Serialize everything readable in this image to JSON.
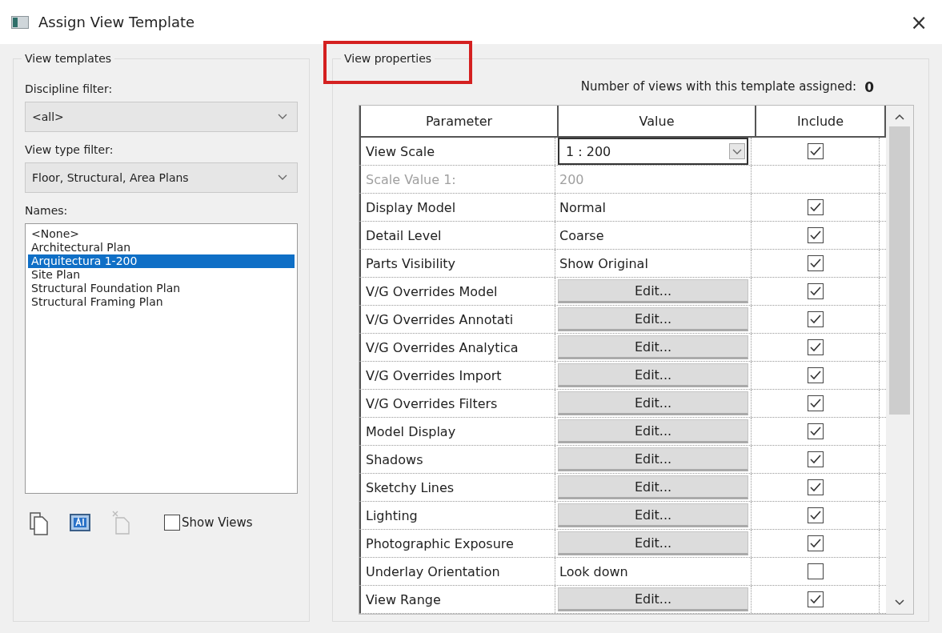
{
  "window": {
    "title": "Assign View Template",
    "close": "×"
  },
  "view_templates": {
    "legend": "View templates",
    "discipline_label": "Discipline filter:",
    "discipline_value": "<all>",
    "type_label": "View type filter:",
    "type_value": "Floor, Structural, Area Plans",
    "names_label": "Names:",
    "names": [
      {
        "label": "<None>",
        "selected": false
      },
      {
        "label": "Architectural Plan",
        "selected": false
      },
      {
        "label": "Arquitectura 1-200",
        "selected": true
      },
      {
        "label": "Site Plan",
        "selected": false
      },
      {
        "label": "Structural Foundation Plan",
        "selected": false
      },
      {
        "label": "Structural Framing Plan",
        "selected": false
      }
    ],
    "show_views": {
      "label": "Show Views",
      "checked": false
    }
  },
  "view_properties": {
    "legend": "View properties",
    "highlighted": true,
    "count_label": "Number of views with this template assigned:",
    "count": "0",
    "columns": [
      "Parameter",
      "Value",
      "Include"
    ],
    "rows": [
      {
        "parameter": "View Scale",
        "kind": "dropdown",
        "value": "1 : 200",
        "disabled": false,
        "include": true
      },
      {
        "parameter": "Scale Value    1:",
        "kind": "text",
        "value": "200",
        "disabled": true
      },
      {
        "parameter": "Display Model",
        "kind": "text",
        "value": "Normal",
        "disabled": false,
        "include": true
      },
      {
        "parameter": "Detail Level",
        "kind": "text",
        "value": "Coarse",
        "disabled": false,
        "include": true
      },
      {
        "parameter": "Parts Visibility",
        "kind": "text",
        "value": "Show Original",
        "disabled": false,
        "include": true
      },
      {
        "parameter": "V/G Overrides Model",
        "kind": "button",
        "value": "Edit...",
        "disabled": false,
        "include": true
      },
      {
        "parameter": "V/G Overrides Annotati",
        "kind": "button",
        "value": "Edit...",
        "disabled": false,
        "include": true
      },
      {
        "parameter": "V/G Overrides Analytica",
        "kind": "button",
        "value": "Edit...",
        "disabled": false,
        "include": true
      },
      {
        "parameter": "V/G Overrides Import",
        "kind": "button",
        "value": "Edit...",
        "disabled": false,
        "include": true
      },
      {
        "parameter": "V/G Overrides Filters",
        "kind": "button",
        "value": "Edit...",
        "disabled": false,
        "include": true
      },
      {
        "parameter": "Model Display",
        "kind": "button",
        "value": "Edit...",
        "disabled": false,
        "include": true
      },
      {
        "parameter": "Shadows",
        "kind": "button",
        "value": "Edit...",
        "disabled": false,
        "include": true
      },
      {
        "parameter": "Sketchy Lines",
        "kind": "button",
        "value": "Edit...",
        "disabled": false,
        "include": true
      },
      {
        "parameter": "Lighting",
        "kind": "button",
        "value": "Edit...",
        "disabled": false,
        "include": true
      },
      {
        "parameter": "Photographic Exposure",
        "kind": "button",
        "value": "Edit...",
        "disabled": false,
        "include": true
      },
      {
        "parameter": "Underlay Orientation",
        "kind": "text",
        "value": "Look down",
        "disabled": false,
        "include": false
      },
      {
        "parameter": "View Range",
        "kind": "button",
        "value": "Edit...",
        "disabled": false,
        "include": true
      }
    ]
  }
}
